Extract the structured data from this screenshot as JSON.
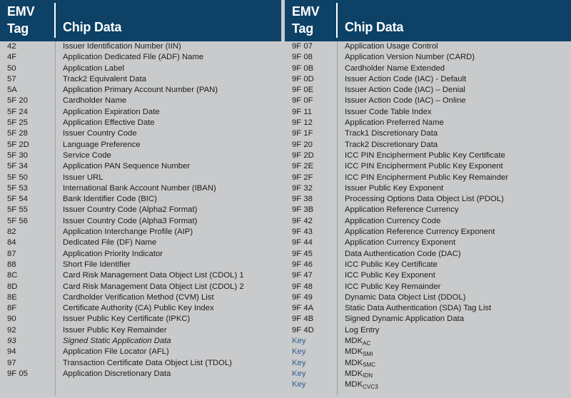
{
  "colors": {
    "header_bg": "#0d4165",
    "header_text": "#ffffff",
    "body_bg": "#c9cacb",
    "body_text": "#1b1b1b",
    "key_text": "#2f5f8f",
    "rule": "#9ea1a4"
  },
  "tables": [
    {
      "id": "left",
      "header": {
        "tag_line1": "EMV",
        "tag_line2": "Tag",
        "data": "Chip Data"
      },
      "rows": [
        {
          "tag": "42",
          "data": "Issuer Identification Number (IIN)"
        },
        {
          "tag": "4F",
          "data": "Application Dedicated File  (ADF) Name"
        },
        {
          "tag": "50",
          "data": "Application Label"
        },
        {
          "tag": "57",
          "data": "Track2 Equivalent Data"
        },
        {
          "tag": "5A",
          "data": "Application Primary Account Number (PAN)"
        },
        {
          "tag": "5F 20",
          "data": "Cardholder Name"
        },
        {
          "tag": "5F 24",
          "data": "Application Expiration Date"
        },
        {
          "tag": "5F 25",
          "data": "Application Effective Date"
        },
        {
          "tag": "5F 28",
          "data": "Issuer Country Code"
        },
        {
          "tag": "5F 2D",
          "data": "Language Preference"
        },
        {
          "tag": "5F 30",
          "data": "Service Code"
        },
        {
          "tag": "5F 34",
          "data": "Application PAN Sequence Number"
        },
        {
          "tag": "5F 50",
          "data": "Issuer URL"
        },
        {
          "tag": "5F 53",
          "data": "International Bank Account Number (IBAN)"
        },
        {
          "tag": "5F 54",
          "data": "Bank Identifier Code (BIC)"
        },
        {
          "tag": "5F 55",
          "data": "Issuer Country Code (Alpha2 Format)"
        },
        {
          "tag": "5F 56",
          "data": "Issuer Country Code (Alpha3 Format)"
        },
        {
          "tag": "82",
          "data": "Application Interchange Profile (AIP)"
        },
        {
          "tag": "84",
          "data": "Dedicated File (DF) Name"
        },
        {
          "tag": "87",
          "data": "Application Priority Indicator"
        },
        {
          "tag": "88",
          "data": "Short File Identifier"
        },
        {
          "tag": "8C",
          "data": "Card Risk Management Data Object List (CDOL) 1"
        },
        {
          "tag": "8D",
          "data": "Card Risk Management Data Object List (CDOL) 2"
        },
        {
          "tag": "8E",
          "data": "Cardholder Verification Method (CVM) List"
        },
        {
          "tag": "8F",
          "data": "Certificate Authority (CA) Public Key Index"
        },
        {
          "tag": "90",
          "data": "Issuer Public Key Certificate (IPKC)"
        },
        {
          "tag": "92",
          "data": "Issuer Public Key Remainder"
        },
        {
          "tag": "93",
          "data": "Signed Static Application Data",
          "style": "italic"
        },
        {
          "tag": "94",
          "data": "Application File Locator (AFL)"
        },
        {
          "tag": "97",
          "data": "Transaction Certificate  Data Object  List (TDOL)"
        },
        {
          "tag": "9F 05",
          "data": "Application Discretionary Data"
        }
      ]
    },
    {
      "id": "right",
      "header": {
        "tag_line1": "EMV",
        "tag_line2": "Tag",
        "data": "Chip Data"
      },
      "rows": [
        {
          "tag": "9F 07",
          "data": "Application Usage Control"
        },
        {
          "tag": "9F 08",
          "data": "Application Version Number (CARD)"
        },
        {
          "tag": "9F 0B",
          "data": "Cardholder Name Extended"
        },
        {
          "tag": "9F 0D",
          "data": "Issuer Action Code (IAC) - Default"
        },
        {
          "tag": "9F 0E",
          "data": "Issuer Action Code (IAC) – Denial"
        },
        {
          "tag": "9F 0F",
          "data": "Issuer Action Code (IAC) – Online"
        },
        {
          "tag": "9F 11",
          "data": "Issuer Code Table Index"
        },
        {
          "tag": "9F 12",
          "data": "Application Preferred Name"
        },
        {
          "tag": "9F 1F",
          "data": "Track1 Discretionary Data"
        },
        {
          "tag": "9F 20",
          "data": "Track2 Discretionary Data"
        },
        {
          "tag": "9F 2D",
          "data": "ICC PIN Encipherment Public Key Certificate"
        },
        {
          "tag": "9F 2E",
          "data": "ICC PIN Encipherment Public Key Exponent"
        },
        {
          "tag": "9F 2F",
          "data": "ICC PIN Encipherment Public Key Remainder"
        },
        {
          "tag": "9F 32",
          "data": "Issuer Public Key Exponent"
        },
        {
          "tag": "9F 38",
          "data": "Processing Options Data Object List (PDOL)"
        },
        {
          "tag": "9F 3B",
          "data": "Application Reference Currency"
        },
        {
          "tag": "9F 42",
          "data": "Application Currency Code"
        },
        {
          "tag": "9F 43",
          "data": "Application Reference Currency Exponent"
        },
        {
          "tag": "9F 44",
          "data": "Application Currency Exponent"
        },
        {
          "tag": "9F 45",
          "data": "Data Authentication Code (DAC)"
        },
        {
          "tag": "9F 46",
          "data": "ICC Public Key Certificate"
        },
        {
          "tag": "9F 47",
          "data": "ICC Public Key Exponent"
        },
        {
          "tag": "9F 48",
          "data": "ICC Public Key Remainder"
        },
        {
          "tag": "9F 49",
          "data": "Dynamic Data Object List (DDOL)"
        },
        {
          "tag": "9F 4A",
          "data": "Static Data Authentication (SDA) Tag List"
        },
        {
          "tag": "9F 4B",
          "data": "Signed Dynamic Application Data"
        },
        {
          "tag": "9F 4D",
          "data": "Log Entry"
        },
        {
          "tag": "Key",
          "data": "MDK",
          "sub": "AC",
          "style": "key"
        },
        {
          "tag": "Key",
          "data": "MDK",
          "sub": "SMI",
          "style": "key"
        },
        {
          "tag": "Key",
          "data": "MDK",
          "sub": "SMC",
          "style": "key"
        },
        {
          "tag": "Key",
          "data": "MDK",
          "sub": "IDN",
          "style": "key"
        },
        {
          "tag": "Key",
          "data": "MDK",
          "sub": "CVC3",
          "style": "key"
        }
      ]
    }
  ]
}
